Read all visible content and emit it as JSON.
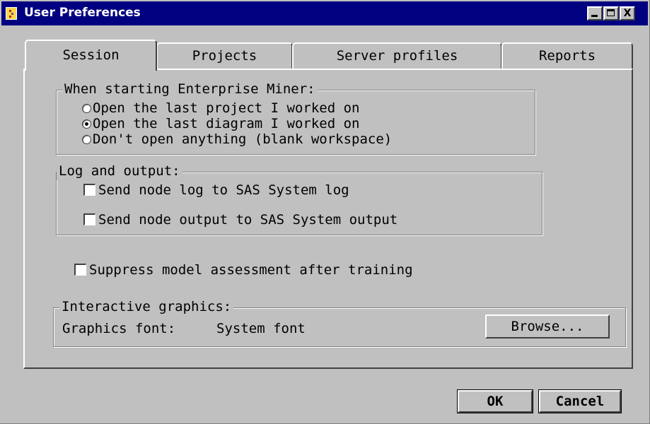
{
  "window": {
    "title": "User Preferences",
    "controls": {
      "minimize": "_",
      "maximize": "□",
      "close": "X"
    }
  },
  "tabs": [
    {
      "label": "Session",
      "active": true
    },
    {
      "label": "Projects",
      "active": false
    },
    {
      "label": "Server profiles",
      "active": false
    },
    {
      "label": "Reports",
      "active": false
    }
  ],
  "session": {
    "startup": {
      "legend": "When starting Enterprise Miner:",
      "options": [
        {
          "label": "Open the last project I worked on",
          "selected": false
        },
        {
          "label": "Open the last diagram I worked on",
          "selected": true
        },
        {
          "label": "Don't open anything (blank workspace)",
          "selected": false
        }
      ]
    },
    "log_output": {
      "legend": "Log and output:",
      "options": [
        {
          "label": "Send node log to SAS System log",
          "checked": false
        },
        {
          "label": "Send node output to SAS System output",
          "checked": false
        }
      ]
    },
    "suppress": {
      "label": "Suppress model assessment after training",
      "checked": false
    },
    "graphics": {
      "legend": "Interactive graphics:",
      "font_label": "Graphics font:",
      "font_value": "System font",
      "browse_label": "Browse..."
    }
  },
  "footer": {
    "ok_label": "OK",
    "cancel_label": "Cancel"
  }
}
